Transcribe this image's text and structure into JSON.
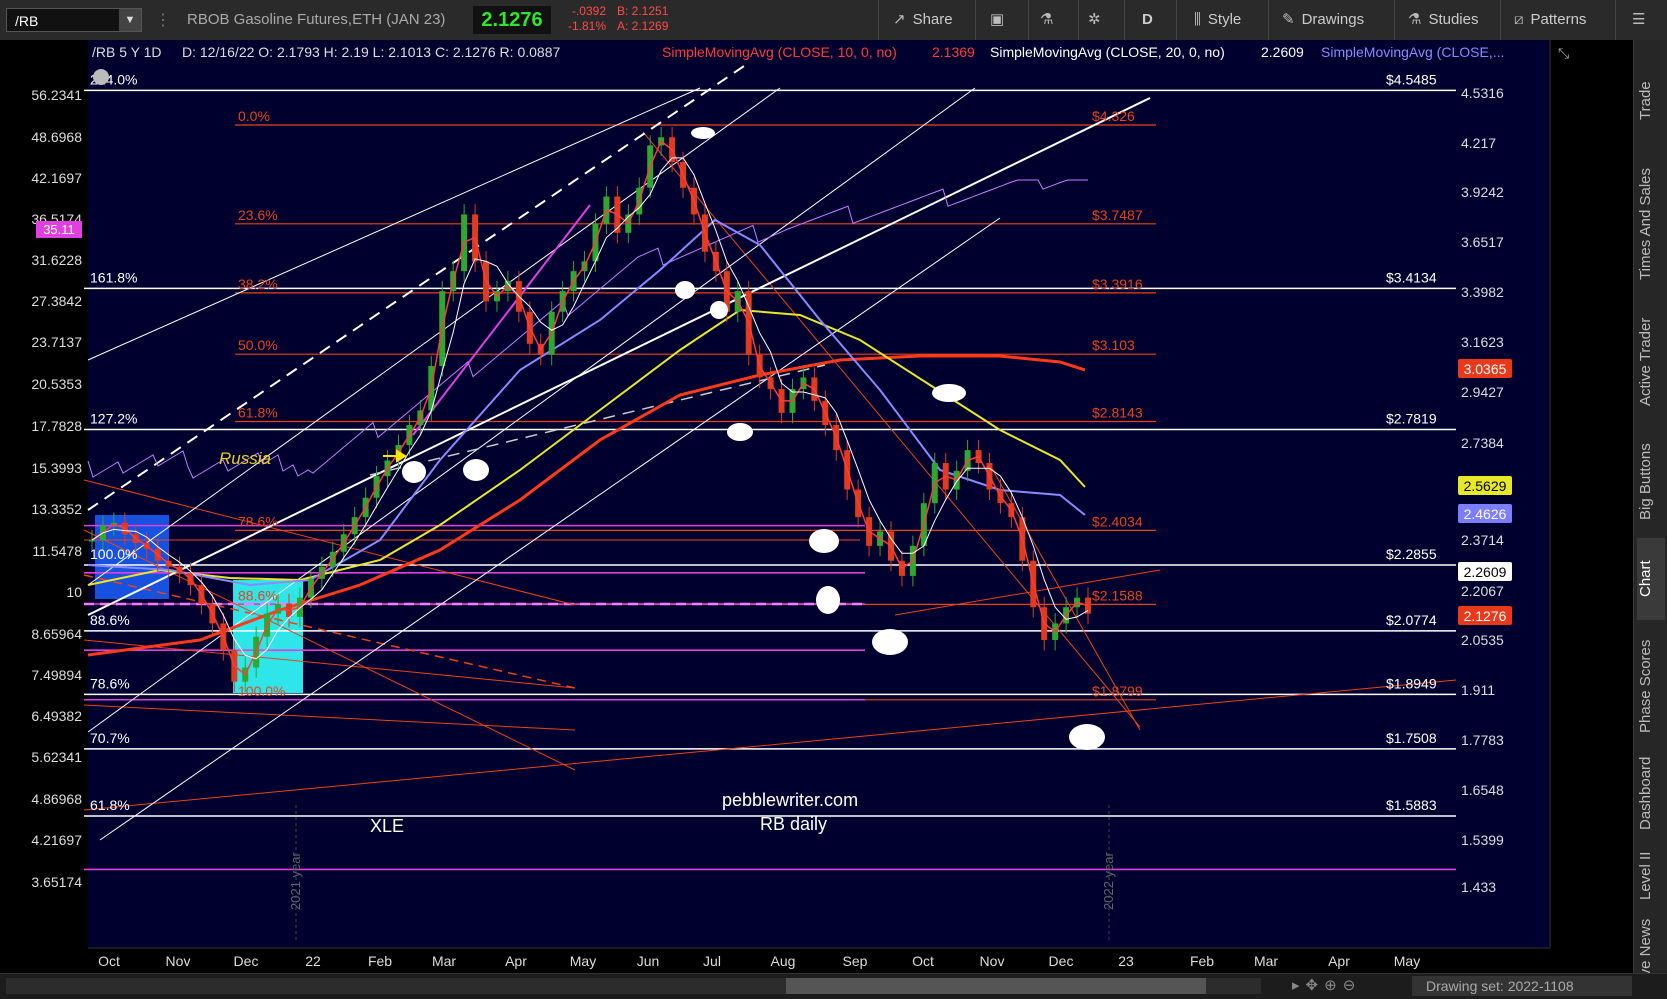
{
  "toolbar": {
    "symbol": "/RB",
    "description": "RBOB Gasoline Futures,ETH (JAN 23)",
    "last": "2.1276",
    "change": "-.0392",
    "change_pct": "-1.81%",
    "bid": "B: 2.1251",
    "ask": "A: 2.1269",
    "share": "Share",
    "period": "D",
    "style": "Style",
    "drawings": "Drawings",
    "studies": "Studies",
    "patterns": "Patterns"
  },
  "rail_tabs": [
    "Trade",
    "Times And Sales",
    "Active Trader",
    "Big Buttons",
    "Chart",
    "Phase Scores",
    "Dashboard",
    "Level II",
    "Live News"
  ],
  "bottom": {
    "drawing_set": "Drawing set: 2022-1108"
  },
  "colors": {
    "candle_up": "#2ea82e",
    "candle_down": "#e03b1e",
    "sma10": "#ff3b3b",
    "sma20": "#ffffff",
    "sma50": "#8a8aff",
    "sma100": "#e8e82a",
    "sma200": "#ff3a1a",
    "xle": "#c77dff",
    "bg": "#000030",
    "fib_orange": "#e8441a",
    "hline": "#ffffff",
    "pink": "#e040e0",
    "cyan_box": "#33ffff",
    "blue_box": "#1a5fff"
  },
  "header": {
    "prefix": "/RB 5 Y 1D",
    "ohlc": "D: 12/16/22  O: 2.1793  H: 2.19  L: 2.1013  C: 2.1276  R: 0.0887",
    "sma10": "SimpleMovingAvg (CLOSE, 10, 0, no)",
    "sma10_val": "2.1369",
    "sma20": "SimpleMovingAvg (CLOSE, 20, 0, no)",
    "sma20_val": "2.2609",
    "sma_more": "SimpleMovingAvg (CLOSE,..."
  },
  "chart_data": {
    "type": "line",
    "symbol": "/RB",
    "interval": "1D",
    "x_labels": [
      "Oct",
      "Nov",
      "Dec",
      "22",
      "Feb",
      "Mar",
      "Apr",
      "May",
      "Jun",
      "Jul",
      "Aug",
      "Sep",
      "Oct",
      "Nov",
      "Dec",
      "23",
      "Feb",
      "Mar",
      "Apr",
      "May"
    ],
    "right_axis_ticks": [
      "4.5316",
      "4.217",
      "3.9242",
      "3.6517",
      "3.3982",
      "3.1623",
      "2.9427",
      "2.7384",
      "2.5629",
      "2.3714",
      "2.2067",
      "2.0535",
      "1.911",
      "1.7783",
      "1.6548",
      "1.5399",
      "1.433"
    ],
    "right_axis_log": true,
    "left_axis_ticks": [
      "56.2341",
      "48.6968",
      "42.1697",
      "36.5174",
      "31.6228",
      "27.3842",
      "23.7137",
      "20.5353",
      "17.7828",
      "15.3993",
      "13.3352",
      "11.5478",
      "10",
      "8.65964",
      "7.49894",
      "6.49382",
      "5.62341",
      "4.86968",
      "4.21697",
      "3.65174"
    ],
    "left_axis_label_box": "35.11",
    "price_badges": [
      {
        "label": "3.0365",
        "color": "#e8391a"
      },
      {
        "label": "2.5629",
        "color": "#e8e82a"
      },
      {
        "label": "2.4626",
        "color": "#7d7dff"
      },
      {
        "label": "2.2609",
        "color": "#ffffff"
      },
      {
        "label": "2.1276",
        "color": "#e8391a"
      }
    ],
    "fib_left_labels": [
      {
        "label": "0.0%",
        "price": 4.326
      },
      {
        "label": "23.6%",
        "price": 3.7487
      },
      {
        "label": "38.2%",
        "price": 3.3916
      },
      {
        "label": "50.0%",
        "price": 3.103
      },
      {
        "label": "61.8%",
        "price": 2.8143
      },
      {
        "label": "78.6%",
        "price": 2.4034
      },
      {
        "label": "88.6%",
        "price": 2.1588
      },
      {
        "label": "100.0%",
        "price": 1.8799
      }
    ],
    "fib_right_labels": [
      "$4.326",
      "$3.7487",
      "$3.3916",
      "$3.103",
      "$2.8143",
      "$2.4034",
      "$2.1588",
      "$1.8799"
    ],
    "white_levels": [
      {
        "left": "224.0%",
        "right": "$4.5485",
        "price": 4.5485
      },
      {
        "left": "161.8%",
        "right": "$3.4134",
        "price": 3.4134
      },
      {
        "left": "127.2%",
        "right": "$2.7819",
        "price": 2.7819
      },
      {
        "left": "100.0%",
        "right": "$2.2855",
        "price": 2.2855
      },
      {
        "left": "88.6%",
        "right": "$2.0774",
        "price": 2.0774
      },
      {
        "left": "78.6%",
        "right": "$1.8949",
        "price": 1.8949
      },
      {
        "left": "70.7%",
        "right": "$1.7508",
        "price": 1.7508
      },
      {
        "left": "61.8%",
        "right": "$1.5883",
        "price": 1.5883
      }
    ],
    "annotations": {
      "russia": "Russia",
      "site": "pebblewriter.com",
      "subtitle": "RB daily",
      "xle": "XLE",
      "year_2021": "2021 year",
      "year_2022": "2022 year"
    },
    "series": [
      {
        "name": "SimpleMovingAvg (CLOSE, 10, 0, no)",
        "values": [
          2.37,
          2.36,
          2.4,
          2.3,
          2.2,
          2.25,
          2.41,
          2.52,
          2.72,
          2.9,
          3.05,
          3.25,
          3.45,
          3.55,
          3.9,
          4.1,
          4.15,
          3.8,
          3.45,
          3.2,
          2.95,
          2.7,
          2.45,
          2.4,
          2.55,
          2.6,
          2.7,
          2.45,
          2.15
        ]
      },
      {
        "name": "SimpleMovingAvg (CLOSE, 20, 0, no)",
        "values": [
          2.3,
          2.32,
          2.36,
          2.3,
          2.22,
          2.22,
          2.35,
          2.48,
          2.65,
          2.88,
          3.0,
          3.18,
          3.38,
          3.52,
          3.8,
          4.0,
          4.05,
          3.85,
          3.52,
          3.25,
          3.0,
          2.75,
          2.5,
          2.4,
          2.5,
          2.58,
          2.66,
          2.52,
          2.26
        ]
      }
    ],
    "price_path": [
      2.37,
      2.42,
      2.43,
      2.39,
      2.36,
      2.34,
      2.3,
      2.28,
      2.26,
      2.22,
      2.16,
      2.1,
      2.02,
      1.93,
      1.97,
      2.06,
      2.13,
      2.16,
      2.12,
      2.18,
      2.24,
      2.28,
      2.33,
      2.39,
      2.45,
      2.52,
      2.6,
      2.66,
      2.72,
      2.8,
      2.86,
      3.05,
      3.4,
      3.5,
      3.8,
      3.55,
      3.35,
      3.4,
      3.45,
      3.3,
      3.15,
      3.1,
      3.3,
      3.4,
      3.5,
      3.55,
      3.75,
      3.9,
      3.7,
      3.8,
      3.95,
      4.2,
      4.25,
      4.1,
      3.95,
      3.8,
      3.6,
      3.5,
      3.3,
      3.4,
      3.1,
      3.0,
      2.95,
      2.85,
      2.95,
      3.0,
      2.9,
      2.8,
      2.7,
      2.55,
      2.45,
      2.35,
      2.4,
      2.3,
      2.25,
      2.35,
      2.5,
      2.65,
      2.55,
      2.62,
      2.7,
      2.65,
      2.55,
      2.5,
      2.45,
      2.3,
      2.15,
      2.05,
      2.1,
      2.15,
      2.18,
      2.13
    ]
  }
}
